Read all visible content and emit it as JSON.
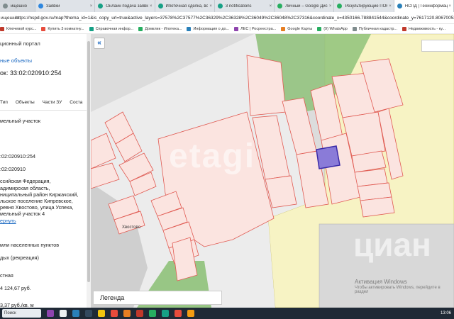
{
  "browser": {
    "tabs": [
      {
        "label": "ищешно",
        "icon": "tab-icon",
        "color": "#7f8c8d"
      },
      {
        "label": "Заявки",
        "icon": "mail-icon",
        "color": "#2e86de"
      },
      {
        "label": "Онлайн подача заявки - ...",
        "icon": "tab-icon",
        "color": "#16a085"
      },
      {
        "label": "Ипотечная сделка, войти...",
        "icon": "tab-icon",
        "color": "#16a085"
      },
      {
        "label": "3 notifications",
        "icon": "tab-icon",
        "color": "#16a085"
      },
      {
        "label": "Личный – Google Диск",
        "icon": "drive-icon",
        "color": "#27ae60"
      },
      {
        "label": "Результирующие ПОКЕ...",
        "icon": "tab-icon",
        "color": "#27ae60"
      },
      {
        "label": "НСПД | Геоинформацио...",
        "icon": "tab-icon",
        "color": "#2980b9"
      }
    ],
    "address_prefix": "ищешно",
    "url": "https://nspd.gov.ru/map?thema_id=1&is_copy_url=true&active_layers=37578%2C37577%2C36329%2C36328%2C36049%2C36048%2C37316&coordinate_x=4350166.788841544&coordinate_y=7617120.806700524&zoom=17.004804...",
    "bookmarks": [
      {
        "label": "Ключевой курс...",
        "color": "#c0392b"
      },
      {
        "label": "Купить 3 комнатну...",
        "color": "#e74c3c"
      },
      {
        "label": "Справочная инфор...",
        "color": "#16a085"
      },
      {
        "label": "Домклик - Ипотека...",
        "color": "#27ae60"
      },
      {
        "label": "Информация о до...",
        "color": "#2980b9"
      },
      {
        "label": "ЛЕС | Росреестра...",
        "color": "#8e44ad"
      },
      {
        "label": "Google Карты",
        "color": "#e67e22"
      },
      {
        "label": "(9) WhatsApp",
        "color": "#27ae60"
      },
      {
        "label": "Публичная кадастр...",
        "color": "#7f8c8d"
      },
      {
        "label": "Недвижимость - ку...",
        "color": "#c0392b"
      }
    ]
  },
  "panel": {
    "portal_title": "ционный портал",
    "objects_link": "ные объекты",
    "cadastral_heading": "ок: 33:02:020910:254",
    "tabs": [
      "Тип",
      "Объекты",
      "Части ЗУ",
      "Соста"
    ],
    "tabs_more": "›",
    "object_type": "мельный участок",
    "cadastral_number": ":02:020910:254",
    "quarter": ":02:020910",
    "address_lines": [
      "ссийская Федерация,",
      "адимирская область,",
      "ниципальный район Киржачский,",
      "льское поселение Кипревское,",
      "ревня Хвостово, улица Успеха,",
      "мельный участок 4"
    ],
    "address_more": "ернуть",
    "category": "мли населенных пунктов",
    "permitted_use": "дых (рекреация)",
    "ownership": "стная",
    "cadastral_value": "4 124,67 руб.",
    "price_per_unit": "3,37 руб./кв. м"
  },
  "map": {
    "collapse_button": "«",
    "street_label": "Хвостово",
    "legend_label": "Легенда",
    "watermark_etagi": "etagi",
    "watermark_cian": "циан",
    "activation_title": "Активация Windows",
    "activation_subtitle": "Чтобы активировать Windows, перейдите в раздел",
    "colors": {
      "background": "#dcdcdc",
      "green_area": "#8fc27a",
      "yellow_area": "#f7f3c4",
      "parcel_fill": "#fbe4e0",
      "parcel_stroke": "#e05a52",
      "selected_fill": "#8a7bd8",
      "selected_stroke": "#3a2aa8"
    }
  },
  "taskbar": {
    "search_placeholder": "Поиск",
    "clock": "13:06"
  }
}
